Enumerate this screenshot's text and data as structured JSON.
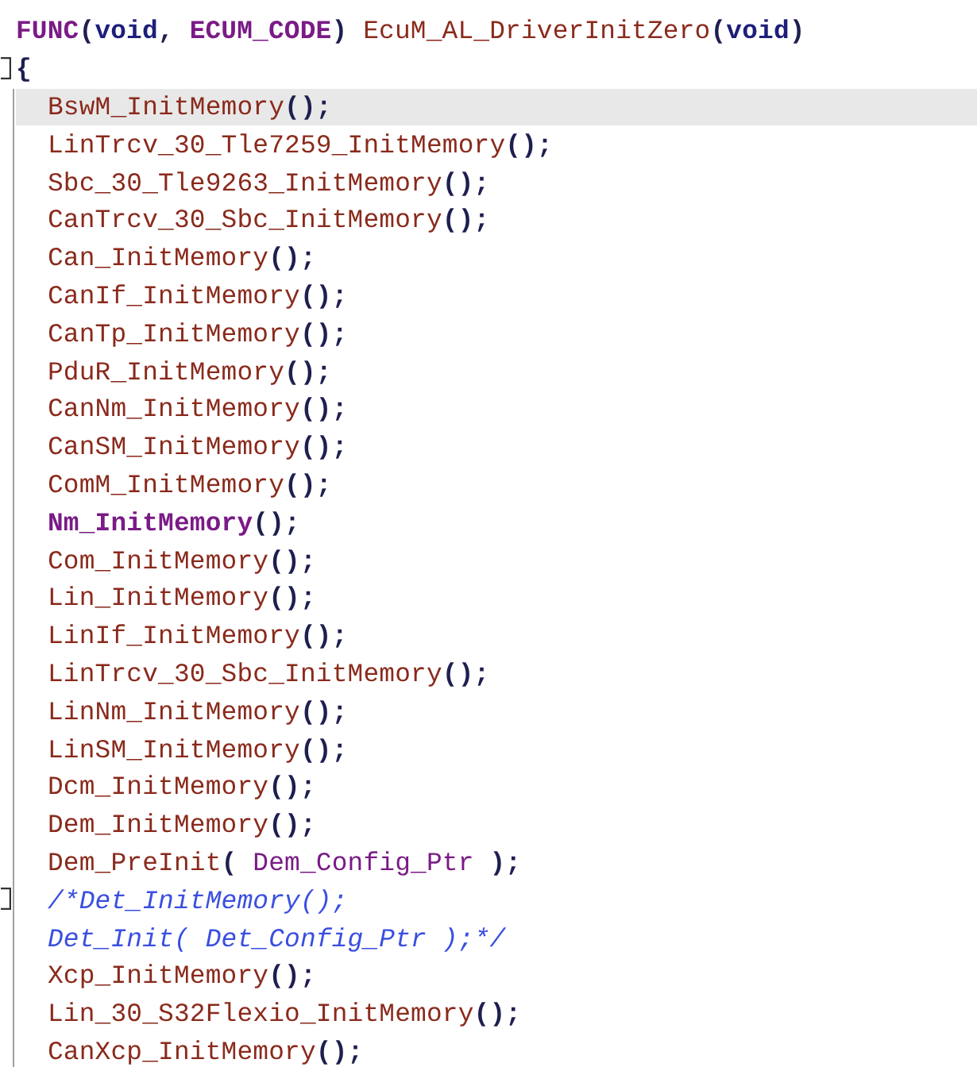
{
  "code": [
    {
      "selected": false,
      "fold": false,
      "tokens": [
        {
          "kind": "macro",
          "text": "FUNC"
        },
        {
          "kind": "punct",
          "text": "("
        },
        {
          "kind": "keyword",
          "text": "void"
        },
        {
          "kind": "punct",
          "text": ", "
        },
        {
          "kind": "macro",
          "text": "ECUM_CODE"
        },
        {
          "kind": "punct",
          "text": ") "
        },
        {
          "kind": "func",
          "text": "EcuM_AL_DriverInitZero"
        },
        {
          "kind": "punct",
          "text": "("
        },
        {
          "kind": "keyword",
          "text": "void"
        },
        {
          "kind": "punct",
          "text": ")"
        }
      ]
    },
    {
      "selected": false,
      "fold": true,
      "tokens": [
        {
          "kind": "punct",
          "text": "{"
        }
      ],
      "children": [
        {
          "selected": true,
          "fold": false,
          "tokens": [
            {
              "kind": "func",
              "text": "BswM_InitMemory"
            },
            {
              "kind": "punct",
              "text": "();"
            }
          ]
        },
        {
          "selected": false,
          "fold": false,
          "tokens": [
            {
              "kind": "func",
              "text": "LinTrcv_30_Tle7259_InitMemory"
            },
            {
              "kind": "punct",
              "text": "();"
            }
          ]
        },
        {
          "selected": false,
          "fold": false,
          "tokens": [
            {
              "kind": "func",
              "text": "Sbc_30_Tle9263_InitMemory"
            },
            {
              "kind": "punct",
              "text": "();"
            }
          ]
        },
        {
          "selected": false,
          "fold": false,
          "tokens": [
            {
              "kind": "func",
              "text": "CanTrcv_30_Sbc_InitMemory"
            },
            {
              "kind": "punct",
              "text": "();"
            }
          ]
        },
        {
          "selected": false,
          "fold": false,
          "tokens": [
            {
              "kind": "func",
              "text": "Can_InitMemory"
            },
            {
              "kind": "punct",
              "text": "();"
            }
          ]
        },
        {
          "selected": false,
          "fold": false,
          "tokens": [
            {
              "kind": "func",
              "text": "CanIf_InitMemory"
            },
            {
              "kind": "punct",
              "text": "();"
            }
          ]
        },
        {
          "selected": false,
          "fold": false,
          "tokens": [
            {
              "kind": "func",
              "text": "CanTp_InitMemory"
            },
            {
              "kind": "punct",
              "text": "();"
            }
          ]
        },
        {
          "selected": false,
          "fold": false,
          "tokens": [
            {
              "kind": "func",
              "text": "PduR_InitMemory"
            },
            {
              "kind": "punct",
              "text": "();"
            }
          ]
        },
        {
          "selected": false,
          "fold": false,
          "tokens": [
            {
              "kind": "func",
              "text": "CanNm_InitMemory"
            },
            {
              "kind": "punct",
              "text": "();"
            }
          ]
        },
        {
          "selected": false,
          "fold": false,
          "tokens": [
            {
              "kind": "func",
              "text": "CanSM_InitMemory"
            },
            {
              "kind": "punct",
              "text": "();"
            }
          ]
        },
        {
          "selected": false,
          "fold": false,
          "tokens": [
            {
              "kind": "func",
              "text": "ComM_InitMemory"
            },
            {
              "kind": "punct",
              "text": "();"
            }
          ]
        },
        {
          "selected": false,
          "fold": false,
          "tokens": [
            {
              "kind": "macro",
              "text": "Nm_InitMemory"
            },
            {
              "kind": "punct",
              "text": "();"
            }
          ]
        },
        {
          "selected": false,
          "fold": false,
          "tokens": [
            {
              "kind": "func",
              "text": "Com_InitMemory"
            },
            {
              "kind": "punct",
              "text": "();"
            }
          ]
        },
        {
          "selected": false,
          "fold": false,
          "tokens": [
            {
              "kind": "func",
              "text": "Lin_InitMemory"
            },
            {
              "kind": "punct",
              "text": "();"
            }
          ]
        },
        {
          "selected": false,
          "fold": false,
          "tokens": [
            {
              "kind": "func",
              "text": "LinIf_InitMemory"
            },
            {
              "kind": "punct",
              "text": "();"
            }
          ]
        },
        {
          "selected": false,
          "fold": false,
          "tokens": [
            {
              "kind": "func",
              "text": "LinTrcv_30_Sbc_InitMemory"
            },
            {
              "kind": "punct",
              "text": "();"
            }
          ]
        },
        {
          "selected": false,
          "fold": false,
          "tokens": [
            {
              "kind": "func",
              "text": "LinNm_InitMemory"
            },
            {
              "kind": "punct",
              "text": "();"
            }
          ]
        },
        {
          "selected": false,
          "fold": false,
          "tokens": [
            {
              "kind": "func",
              "text": "LinSM_InitMemory"
            },
            {
              "kind": "punct",
              "text": "();"
            }
          ]
        },
        {
          "selected": false,
          "fold": false,
          "tokens": [
            {
              "kind": "func",
              "text": "Dcm_InitMemory"
            },
            {
              "kind": "punct",
              "text": "();"
            }
          ]
        },
        {
          "selected": false,
          "fold": false,
          "tokens": [
            {
              "kind": "func",
              "text": "Dem_InitMemory"
            },
            {
              "kind": "punct",
              "text": "();"
            }
          ]
        },
        {
          "selected": false,
          "fold": false,
          "tokens": [
            {
              "kind": "func",
              "text": "Dem_PreInit"
            },
            {
              "kind": "punct",
              "text": "( "
            },
            {
              "kind": "ident",
              "text": "Dem_Config_Ptr"
            },
            {
              "kind": "punct",
              "text": " );"
            }
          ]
        },
        {
          "selected": false,
          "fold": true,
          "tokens": [
            {
              "kind": "comment",
              "text": "/*Det_InitMemory();"
            }
          ]
        },
        {
          "selected": false,
          "fold": false,
          "tokens": [
            {
              "kind": "comment",
              "text": "Det_Init( Det_Config_Ptr );*/"
            }
          ]
        },
        {
          "selected": false,
          "fold": false,
          "tokens": [
            {
              "kind": "func",
              "text": "Xcp_InitMemory"
            },
            {
              "kind": "punct",
              "text": "();"
            }
          ]
        },
        {
          "selected": false,
          "fold": false,
          "tokens": [
            {
              "kind": "func",
              "text": "Lin_30_S32Flexio_InitMemory"
            },
            {
              "kind": "punct",
              "text": "();"
            }
          ]
        },
        {
          "selected": false,
          "fold": false,
          "tokens": [
            {
              "kind": "func",
              "text": "CanXcp_InitMemory"
            },
            {
              "kind": "punct",
              "text": "();"
            }
          ]
        }
      ]
    }
  ]
}
